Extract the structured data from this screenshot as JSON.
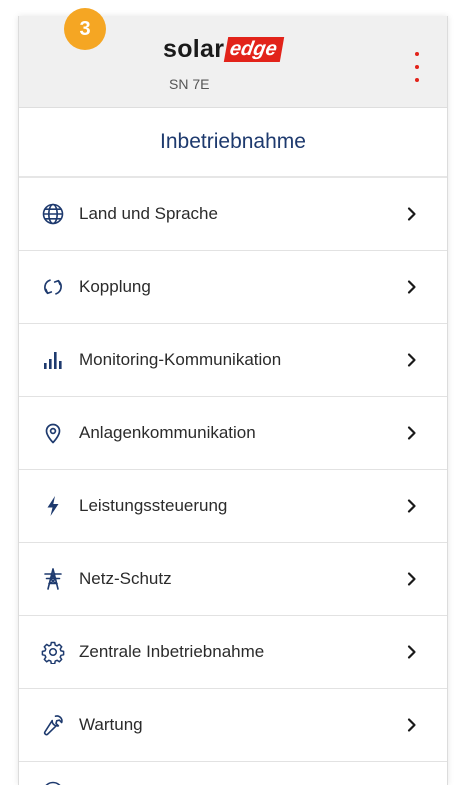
{
  "badge": {
    "step": "3"
  },
  "header": {
    "logo_solar": "solar",
    "logo_edge": "edge",
    "serial": "SN 7E"
  },
  "page": {
    "title": "Inbetriebnahme"
  },
  "colors": {
    "accent_red": "#e2231a",
    "badge_orange": "#f5a623",
    "title_blue": "#1e3a6e"
  },
  "menu": {
    "items": [
      {
        "label": "Land und Sprache",
        "icon": "globe-icon"
      },
      {
        "label": "Kopplung",
        "icon": "sync-icon"
      },
      {
        "label": "Monitoring-Kommunikation",
        "icon": "bar-chart-icon"
      },
      {
        "label": "Anlagenkommunikation",
        "icon": "location-pin-icon"
      },
      {
        "label": "Leistungssteuerung",
        "icon": "lightning-icon"
      },
      {
        "label": "Netz-Schutz",
        "icon": "power-tower-icon"
      },
      {
        "label": "Zentrale Inbetriebnahme",
        "icon": "gear-icon"
      },
      {
        "label": "Wartung",
        "icon": "wrench-icon"
      }
    ]
  }
}
